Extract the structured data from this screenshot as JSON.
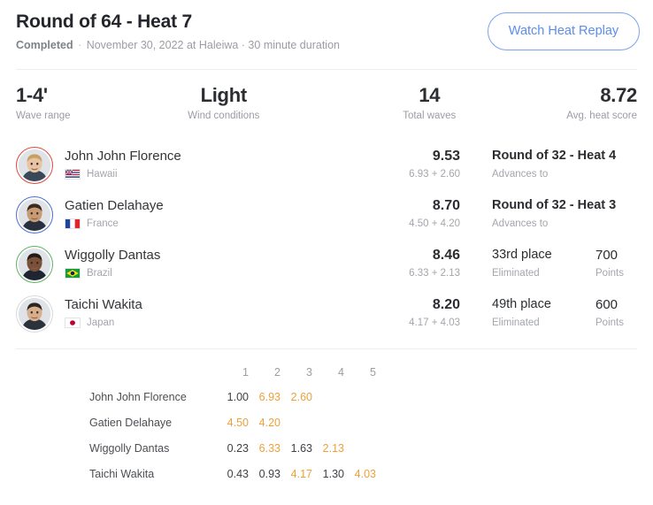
{
  "header": {
    "title": "Round of 64 - Heat 7",
    "status": "Completed",
    "subtitle_rest": "November 30, 2022 at Haleiwa · 30 minute duration",
    "replay_button": "Watch Heat Replay",
    "accent_blue": "#5b8def"
  },
  "stats": [
    {
      "value": "1-4'",
      "label": "Wave range"
    },
    {
      "value": "Light",
      "label": "Wind conditions"
    },
    {
      "value": "14",
      "label": "Total waves"
    },
    {
      "value": "8.72",
      "label": "Avg. heat score"
    }
  ],
  "athletes": [
    {
      "name": "John John Florence",
      "country": "Hawaii",
      "flag": "hawaii",
      "score": "9.53",
      "breakdown": "6.93 + 2.60",
      "result": "Round of 32 - Heat 4",
      "status": "Advances to",
      "points": "",
      "points_label": "",
      "rank_color": "#e1473f"
    },
    {
      "name": "Gatien Delahaye",
      "country": "France",
      "flag": "france",
      "score": "8.70",
      "breakdown": "4.50 + 4.20",
      "result": "Round of 32 - Heat 3",
      "status": "Advances to",
      "points": "",
      "points_label": "",
      "rank_color": "#4a6fd6"
    },
    {
      "name": "Wiggolly Dantas",
      "country": "Brazil",
      "flag": "brazil",
      "score": "8.46",
      "breakdown": "6.33 + 2.13",
      "result": "33rd place",
      "status": "Eliminated",
      "points": "700",
      "points_label": "Points",
      "rank_color": "#5db462"
    },
    {
      "name": "Taichi Wakita",
      "country": "Japan",
      "flag": "japan",
      "score": "8.20",
      "breakdown": "4.17 + 4.03",
      "result": "49th place",
      "status": "Eliminated",
      "points": "600",
      "points_label": "Points",
      "rank_color": "#d8d9dd"
    }
  ],
  "wave_table": {
    "columns": [
      "1",
      "2",
      "3",
      "4",
      "5"
    ],
    "highlight_color": "#eda13a",
    "rows": [
      {
        "name": "John John Florence",
        "scores": [
          {
            "value": "1.00",
            "counted": false
          },
          {
            "value": "6.93",
            "counted": true
          },
          {
            "value": "2.60",
            "counted": true
          },
          {
            "value": "",
            "counted": false
          },
          {
            "value": "",
            "counted": false
          }
        ]
      },
      {
        "name": "Gatien Delahaye",
        "scores": [
          {
            "value": "4.50",
            "counted": true
          },
          {
            "value": "4.20",
            "counted": true
          },
          {
            "value": "",
            "counted": false
          },
          {
            "value": "",
            "counted": false
          },
          {
            "value": "",
            "counted": false
          }
        ]
      },
      {
        "name": "Wiggolly Dantas",
        "scores": [
          {
            "value": "0.23",
            "counted": false
          },
          {
            "value": "6.33",
            "counted": true
          },
          {
            "value": "1.63",
            "counted": false
          },
          {
            "value": "2.13",
            "counted": true
          },
          {
            "value": "",
            "counted": false
          }
        ]
      },
      {
        "name": "Taichi Wakita",
        "scores": [
          {
            "value": "0.43",
            "counted": false
          },
          {
            "value": "0.93",
            "counted": false
          },
          {
            "value": "4.17",
            "counted": true
          },
          {
            "value": "1.30",
            "counted": false
          },
          {
            "value": "4.03",
            "counted": true
          }
        ]
      }
    ]
  }
}
